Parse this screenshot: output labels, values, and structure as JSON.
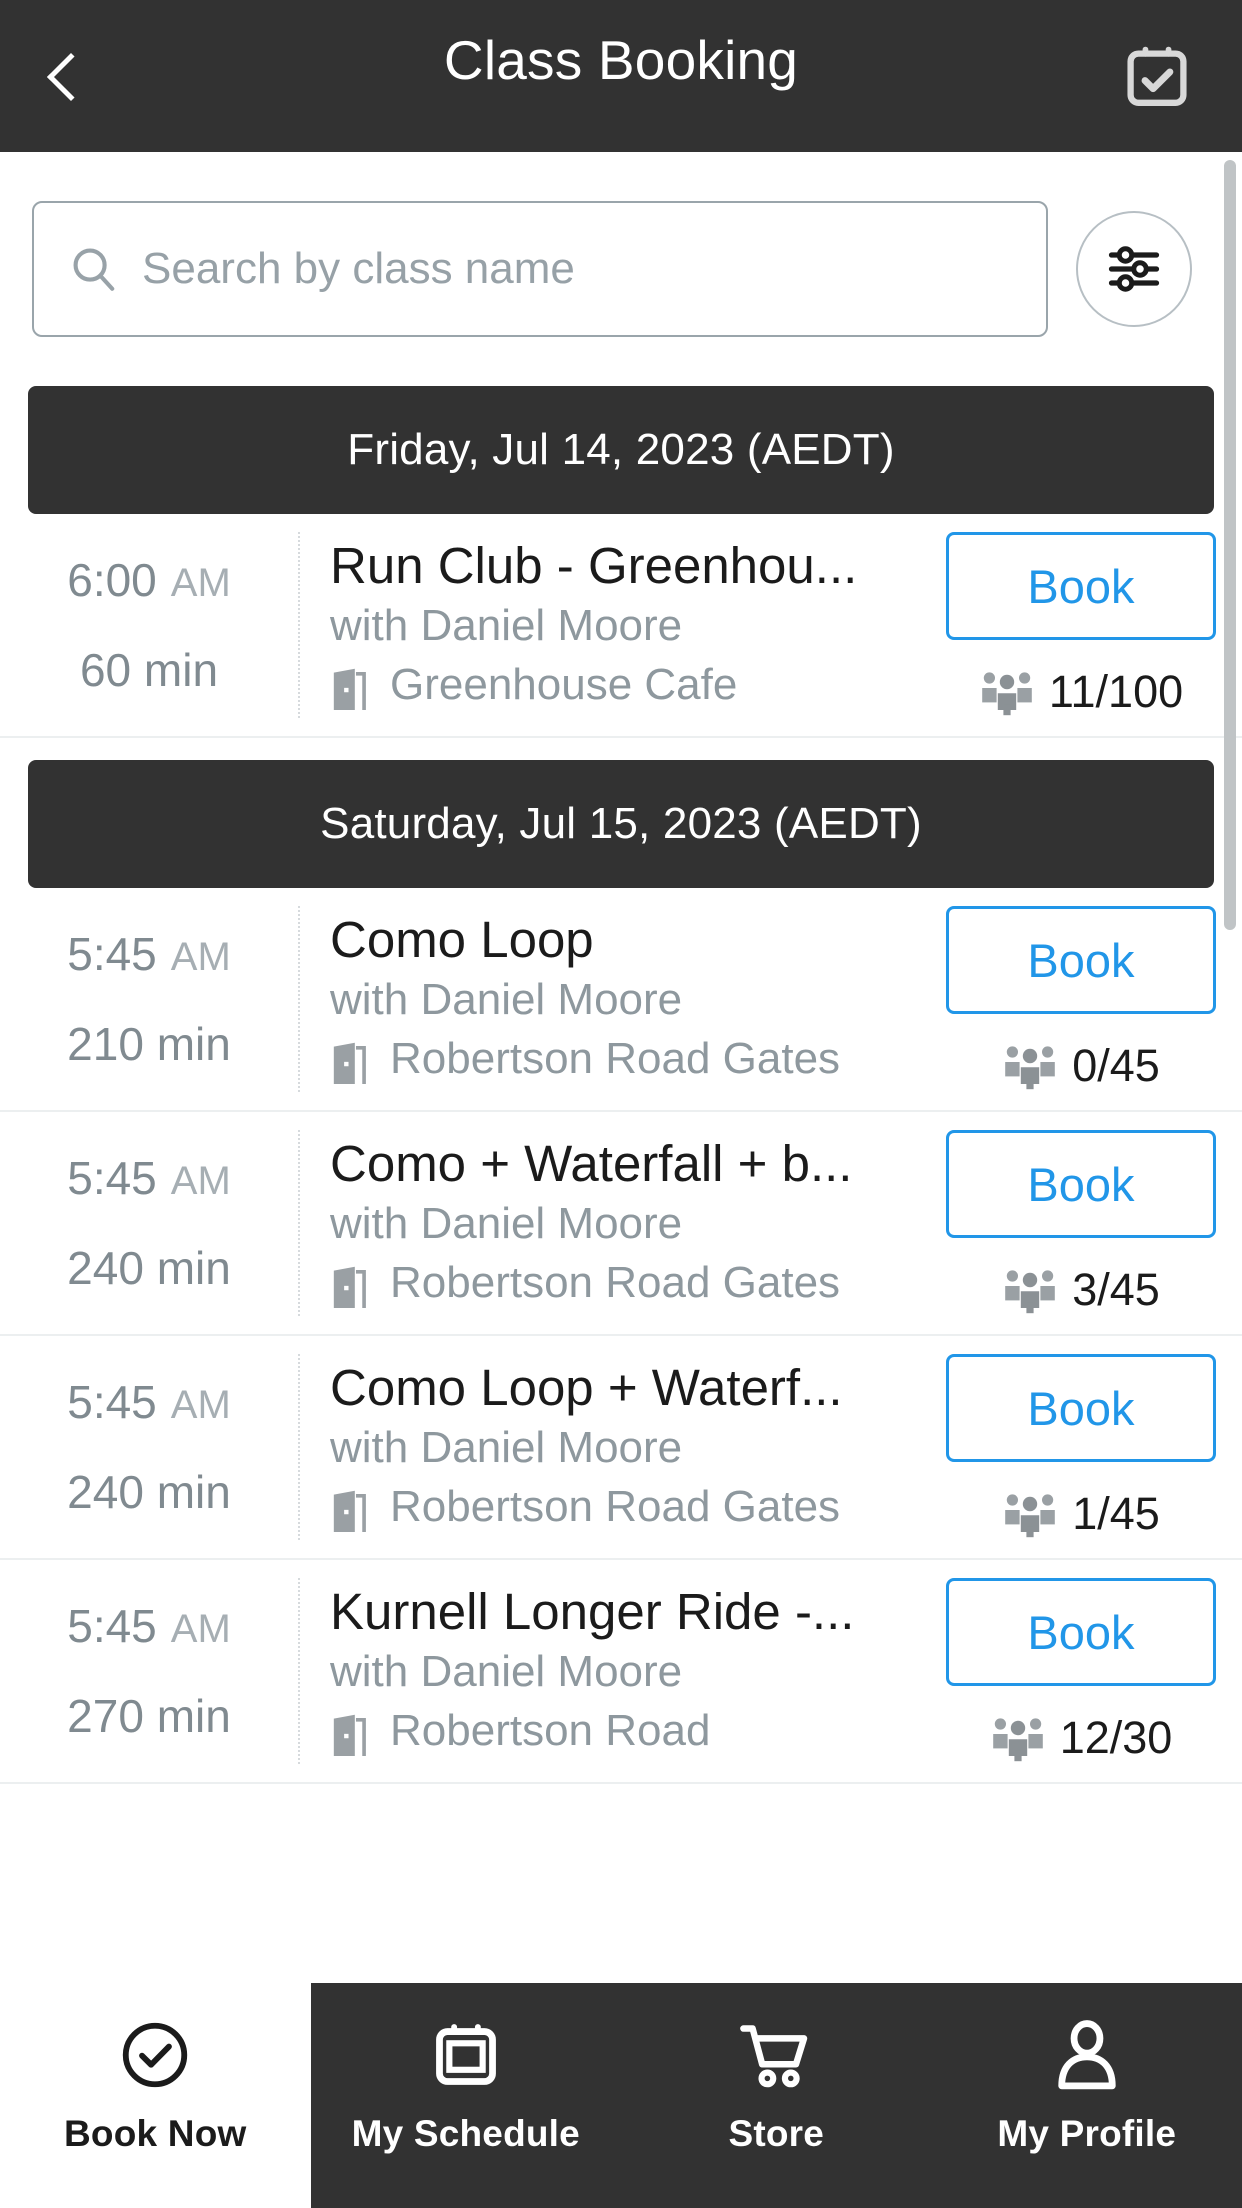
{
  "header": {
    "title": "Class Booking",
    "back_icon": "chevron-left-icon",
    "calendar_icon": "calendar-check-icon"
  },
  "search": {
    "placeholder": "Search by class name",
    "value": "",
    "search_icon": "search-icon",
    "filter_icon": "filter-sliders-icon"
  },
  "colors": {
    "header_bg": "#323232",
    "accent_blue": "#2196e8",
    "muted_text": "#8e989e",
    "nav_bg": "#323232"
  },
  "days": [
    {
      "label": "Friday, Jul 14, 2023 (AEDT)",
      "classes": [
        {
          "time": "6:00",
          "meridiem": "AM",
          "duration": "60 min",
          "title": "Run Club - Greenhou...",
          "instructor": "with Daniel Moore",
          "location": "Greenhouse Cafe",
          "book_label": "Book",
          "capacity": "11/100"
        }
      ]
    },
    {
      "label": "Saturday, Jul 15, 2023 (AEDT)",
      "classes": [
        {
          "time": "5:45",
          "meridiem": "AM",
          "duration": "210 min",
          "title": "Como Loop",
          "instructor": "with Daniel Moore",
          "location": "Robertson Road Gates",
          "book_label": "Book",
          "capacity": "0/45"
        },
        {
          "time": "5:45",
          "meridiem": "AM",
          "duration": "240 min",
          "title": "Como + Waterfall + b...",
          "instructor": "with Daniel Moore",
          "location": "Robertson Road Gates",
          "book_label": "Book",
          "capacity": "3/45"
        },
        {
          "time": "5:45",
          "meridiem": "AM",
          "duration": "240 min",
          "title": "Como Loop + Waterf...",
          "instructor": "with Daniel Moore",
          "location": "Robertson Road Gates",
          "book_label": "Book",
          "capacity": "1/45"
        },
        {
          "time": "5:45",
          "meridiem": "AM",
          "duration": "270 min",
          "title": "Kurnell Longer Ride -...",
          "instructor": "with Daniel Moore",
          "location": "Robertson Road",
          "book_label": "Book",
          "capacity": "12/30"
        }
      ]
    }
  ],
  "bottom_nav": [
    {
      "label": "Book Now",
      "icon": "check-circle-icon",
      "active": true
    },
    {
      "label": "My Schedule",
      "icon": "calendar-icon",
      "active": false
    },
    {
      "label": "Store",
      "icon": "cart-icon",
      "active": false
    },
    {
      "label": "My Profile",
      "icon": "person-icon",
      "active": false
    }
  ]
}
